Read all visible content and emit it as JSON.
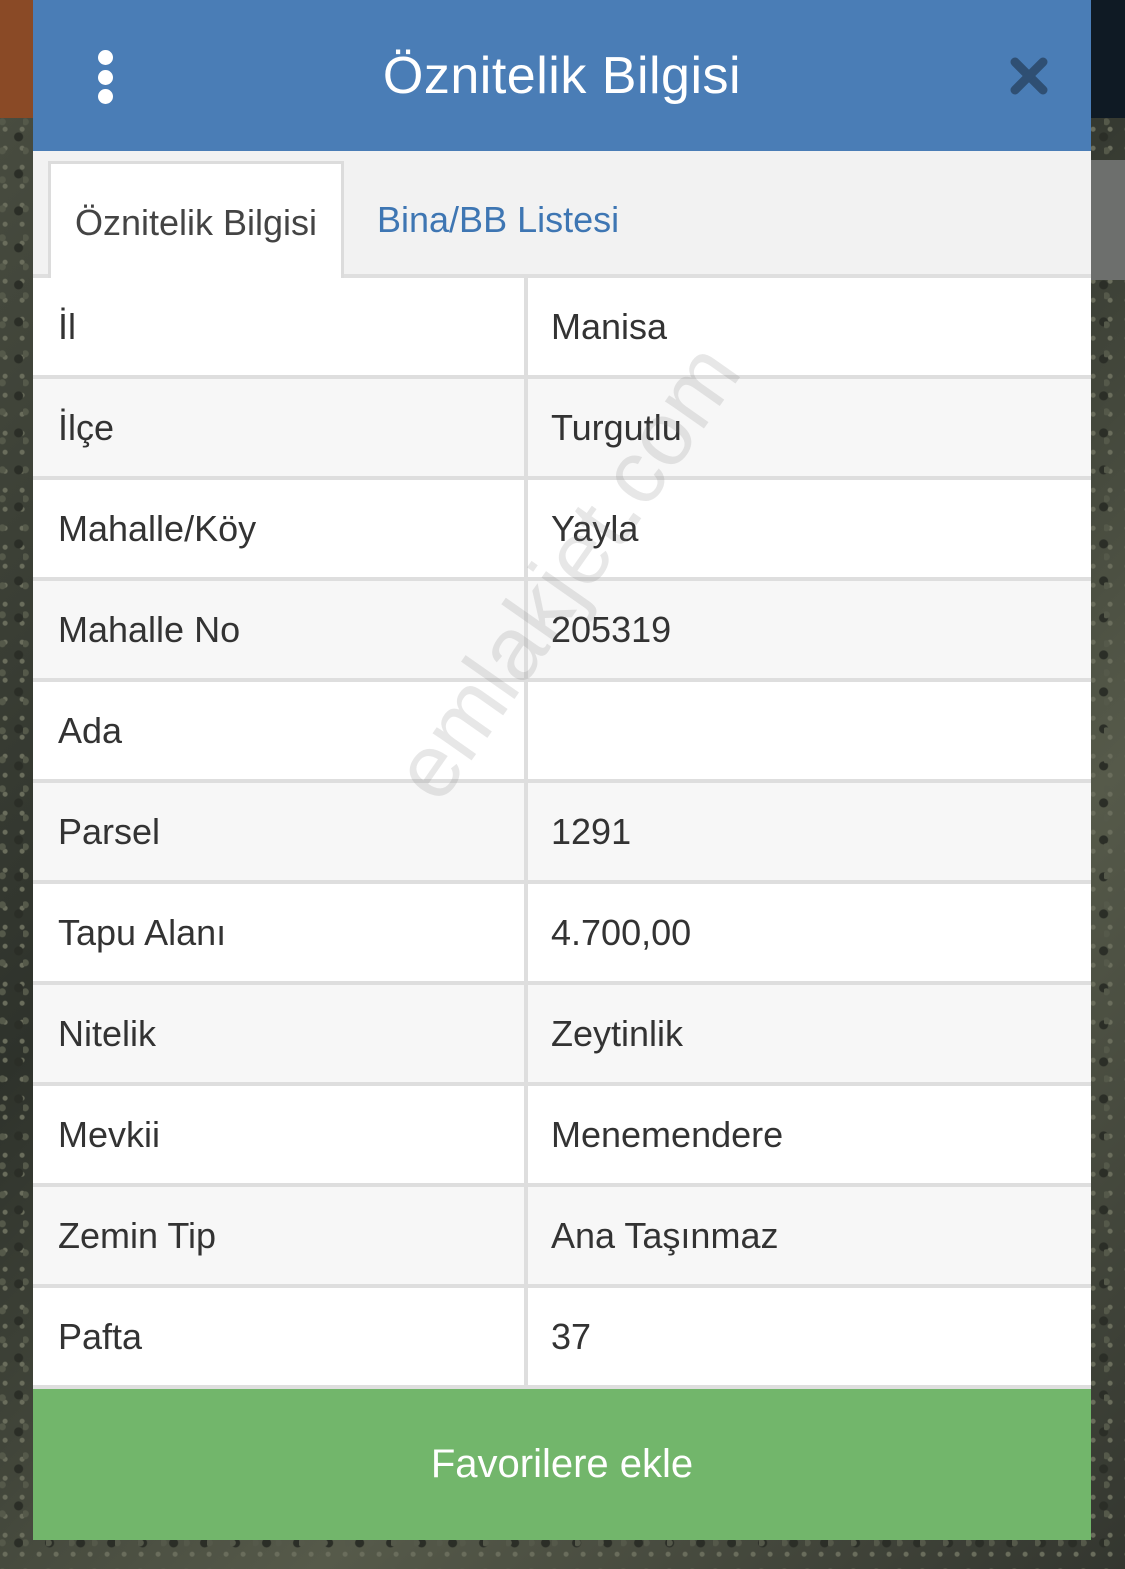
{
  "header": {
    "title": "Öznitelik Bilgisi",
    "menu_icon": "more-vertical-icon",
    "close_icon": "close-icon"
  },
  "tabs": [
    {
      "label": "Öznitelik Bilgisi",
      "active": true
    },
    {
      "label": "Bina/BB Listesi",
      "active": false
    }
  ],
  "attributes": [
    {
      "label": "İl",
      "value": "Manisa"
    },
    {
      "label": "İlçe",
      "value": "Turgutlu"
    },
    {
      "label": "Mahalle/Köy",
      "value": "Yayla"
    },
    {
      "label": "Mahalle No",
      "value": "205319"
    },
    {
      "label": "Ada",
      "value": ""
    },
    {
      "label": "Parsel",
      "value": "1291"
    },
    {
      "label": "Tapu Alanı",
      "value": "4.700,00"
    },
    {
      "label": "Nitelik",
      "value": "Zeytinlik"
    },
    {
      "label": "Mevkii",
      "value": "Menemendere"
    },
    {
      "label": "Zemin Tip",
      "value": "Ana Taşınmaz"
    },
    {
      "label": "Pafta",
      "value": "37"
    }
  ],
  "footer": {
    "favorite_label": "Favorilere ekle"
  },
  "watermark": "emlakjet.com",
  "colors": {
    "header": "#4a7db6",
    "tab_link": "#3e76b3",
    "button": "#72b66b"
  }
}
